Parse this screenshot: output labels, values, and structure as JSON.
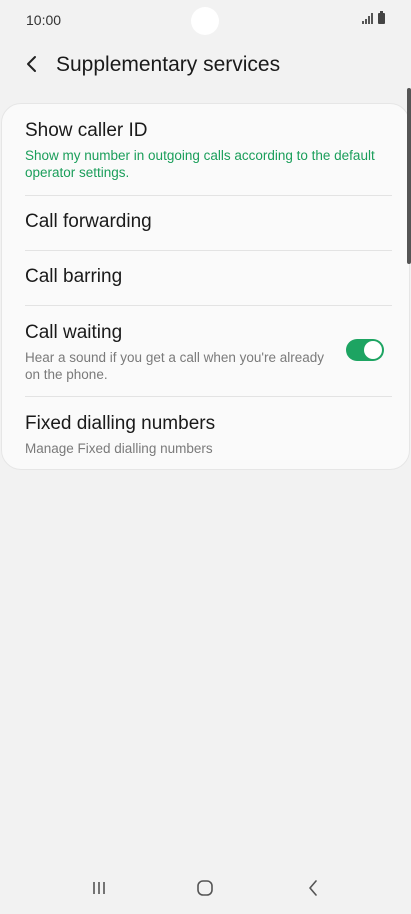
{
  "status_bar": {
    "time": "10:00"
  },
  "header": {
    "title": "Supplementary services"
  },
  "settings": [
    {
      "title": "Show caller ID",
      "subtitle": "Show my number in outgoing calls according to the default operator settings."
    },
    {
      "title": "Call forwarding"
    },
    {
      "title": "Call barring"
    },
    {
      "title": "Call waiting",
      "subtitle": "Hear a sound if you get a call when you're already on the phone.",
      "toggle": "on"
    },
    {
      "title": "Fixed dialling numbers",
      "subtitle": "Manage Fixed dialling numbers"
    }
  ],
  "colors": {
    "accent": "#1a9e5a",
    "toggle_on": "#1da462",
    "background": "#f2f2f2"
  },
  "icons": {
    "back": "chevron-left-icon",
    "nav_recents": "recents-icon",
    "nav_home": "home-icon",
    "nav_back": "back-icon"
  }
}
